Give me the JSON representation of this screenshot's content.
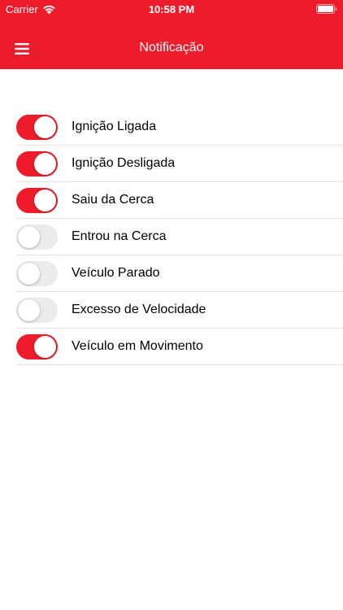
{
  "colors": {
    "accent": "#ee1c2a",
    "toggle_off": "#ebebeb",
    "separator": "#e3e3e3",
    "header_text": "#ffffff"
  },
  "status_bar": {
    "carrier": "Carrier",
    "time": "10:58 PM",
    "icons": [
      "wifi-icon",
      "battery-icon"
    ]
  },
  "nav": {
    "title": "Notificação",
    "menu_icon": "hamburger-menu-icon"
  },
  "notifications": [
    {
      "label": "Ignição Ligada",
      "enabled": true
    },
    {
      "label": "Ignição Desligada",
      "enabled": true
    },
    {
      "label": "Saiu da Cerca",
      "enabled": true
    },
    {
      "label": "Entrou na Cerca",
      "enabled": false
    },
    {
      "label": "Veículo Parado",
      "enabled": false
    },
    {
      "label": "Excesso de Velocidade",
      "enabled": false
    },
    {
      "label": "Veículo em Movimento",
      "enabled": true
    }
  ]
}
